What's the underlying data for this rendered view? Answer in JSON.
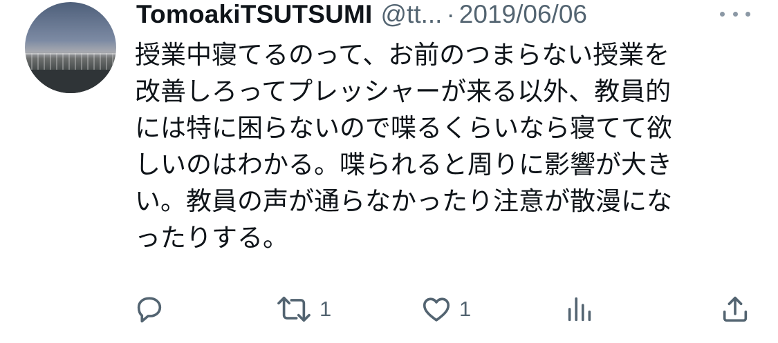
{
  "tweet": {
    "author_name": "TomoakiTSUTSUMI",
    "author_handle": "@tt...",
    "separator": "·",
    "date": "2019/06/06",
    "text": "授業中寝てるのって、お前のつまらない授業を\n改善しろってプレッシャーが来る以外、教員的\nには特に困らないので喋るくらいなら寝てて欲\nしいのはわかる。喋られると周りに影響が大き\nい。教員の声が通らなかったり注意が散漫にな\nったりする。"
  },
  "actions": {
    "reply_icon": "reply-icon",
    "retweet_icon": "retweet-icon",
    "retweet_count": "1",
    "like_icon": "heart-icon",
    "like_count": "1",
    "analytics_icon": "analytics-icon",
    "share_icon": "share-icon"
  },
  "colors": {
    "text_primary": "#0f1419",
    "text_secondary": "#536471",
    "background": "#ffffff"
  }
}
